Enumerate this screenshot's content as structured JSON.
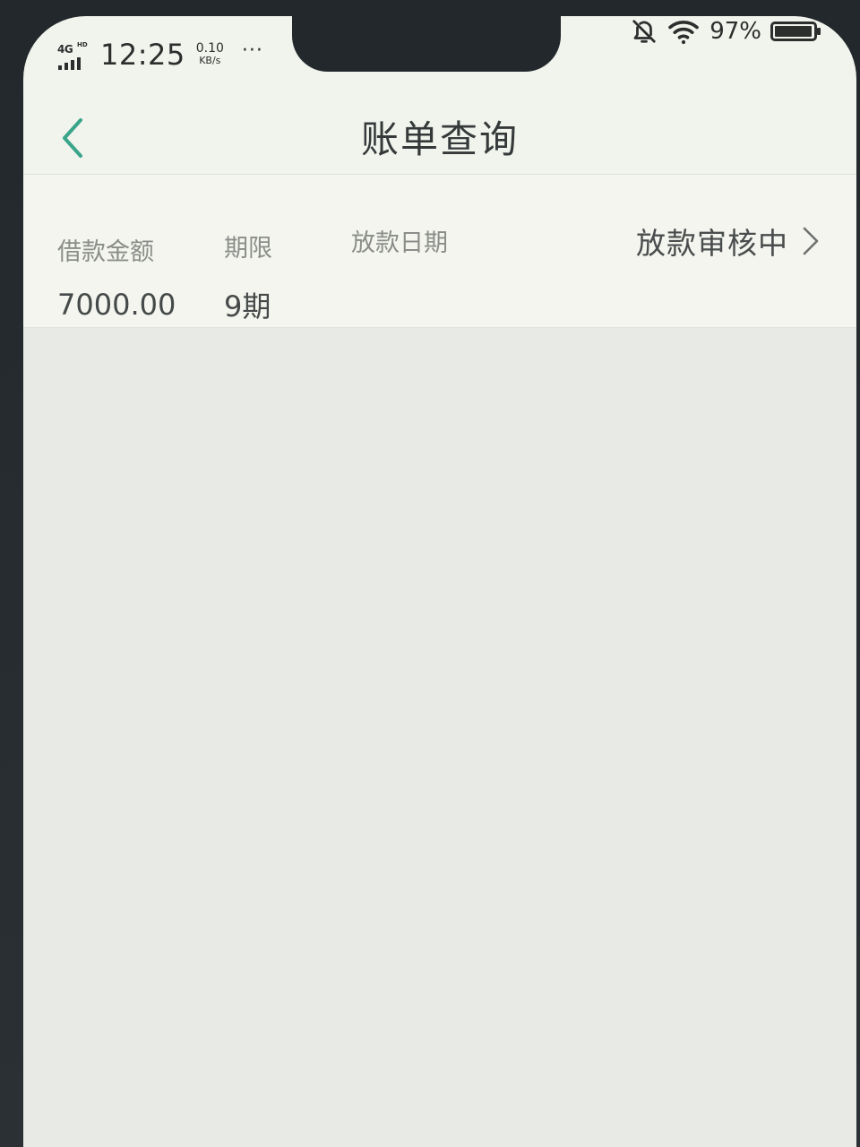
{
  "status_bar": {
    "network": "4G",
    "network_badge": "HD",
    "time": "12:25",
    "speed_value": "0.10",
    "speed_unit": "KB/s",
    "more": "···",
    "battery_percent": "97%",
    "battery_level": 0.97
  },
  "header": {
    "title": "账单查询",
    "back_icon": "chevron-left-icon",
    "accent_color": "#3aa58b"
  },
  "loan": {
    "columns": [
      {
        "label": "借款金额",
        "value": "7000.00"
      },
      {
        "label": "期限",
        "value": "9期"
      },
      {
        "label": "放款日期",
        "value": ""
      }
    ],
    "status_text": "放款审核中",
    "status_icon": "chevron-right-icon"
  }
}
